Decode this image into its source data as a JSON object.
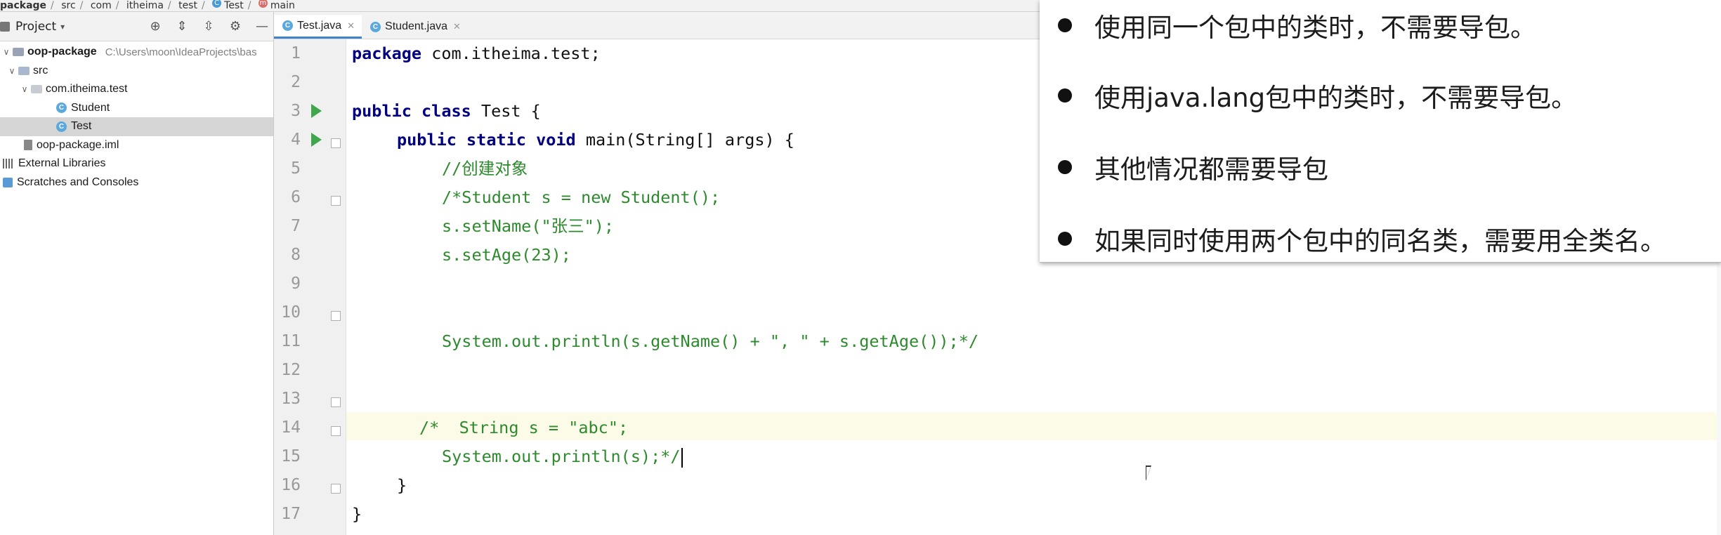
{
  "breadcrumb": [
    "package",
    "src",
    "com",
    "itheima",
    "test",
    "Test",
    "main"
  ],
  "project_panel": {
    "title": "Project",
    "tree": [
      {
        "label": "oop-package",
        "detail": "C:\\Users\\moon\\IdeaProjects\\bas",
        "icon": "module-folder-icon",
        "bold": true
      },
      {
        "label": "src",
        "icon": "source-folder-icon"
      },
      {
        "label": "com.itheima.test",
        "icon": "package-folder-icon"
      },
      {
        "label": "Student",
        "icon": "class-icon"
      },
      {
        "label": "Test",
        "icon": "class-icon",
        "selected": true
      },
      {
        "label": "oop-package.iml",
        "icon": "iml-file-icon"
      },
      {
        "label": "External Libraries",
        "icon": "libraries-icon"
      },
      {
        "label": "Scratches and Consoles",
        "icon": "scratches-icon"
      }
    ]
  },
  "tabs": [
    {
      "label": "Test.java",
      "active": true
    },
    {
      "label": "Student.java",
      "active": false
    }
  ],
  "editor": {
    "line_numbers": [
      "1",
      "2",
      "3",
      "4",
      "5",
      "6",
      "7",
      "8",
      "9",
      "10",
      "11",
      "12",
      "13",
      "14",
      "15",
      "16",
      "17"
    ],
    "current_line": 14,
    "lines": {
      "l1_kw": "package",
      "l1_rest": " com.itheima.test;",
      "l3_kw": "public class",
      "l3_rest": " Test {",
      "l4_kw": "public static void",
      "l4_rest": " main(String[] args) {",
      "l5": "//创建对象",
      "l6": "/*Student s = new Student();",
      "l7": "s.setName(\"张三\");",
      "l8": "s.setAge(23);",
      "l10": "System.out.println(s.getName() + \", \" + s.getAge());*/",
      "l13": "/*  String s = \"abc\";",
      "l14": "System.out.println(s);*/",
      "l15": "}",
      "l16": "}"
    }
  },
  "overlay": {
    "items": [
      "使用同一个包中的类时，不需要导包。",
      "使用java.lang包中的类时，不需要导包。",
      "其他情况都需要导包",
      "如果同时使用两个包中的同名类，需要用全类名。"
    ]
  }
}
